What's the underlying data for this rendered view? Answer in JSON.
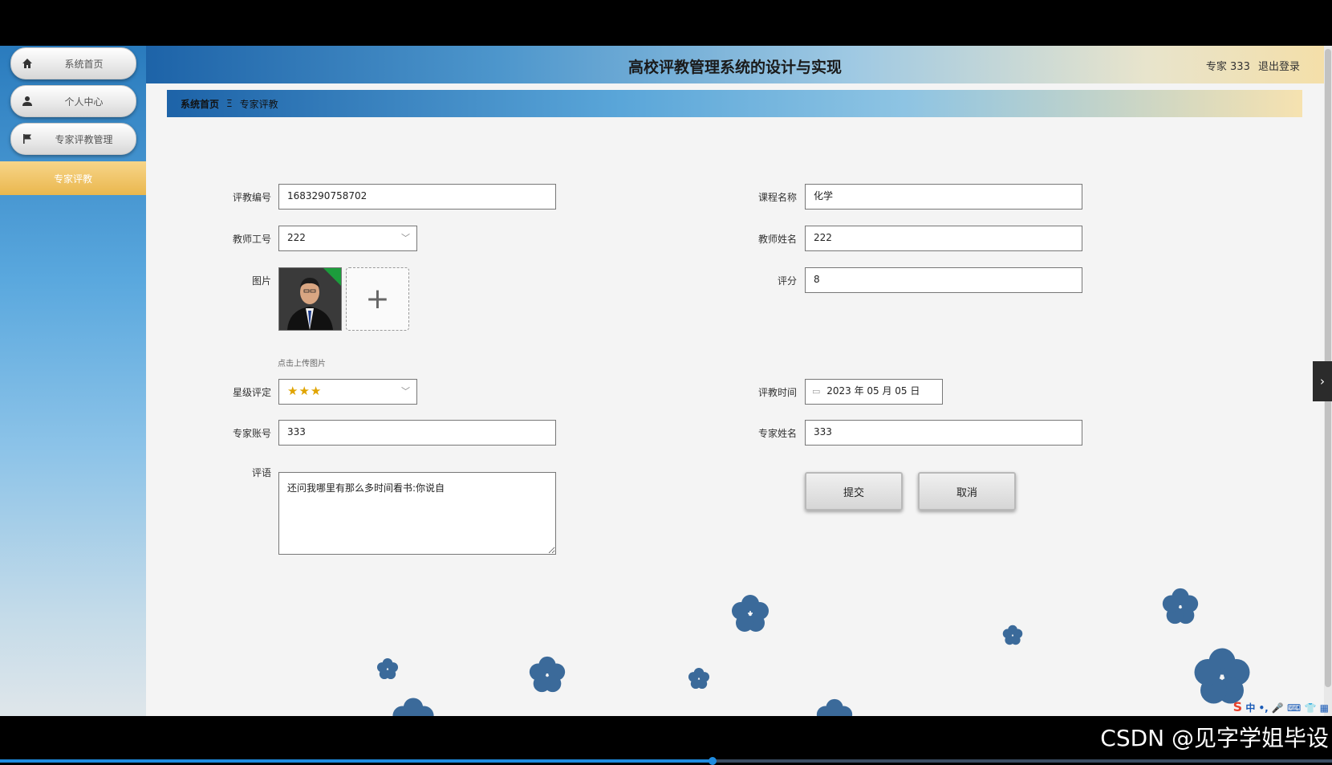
{
  "app": {
    "title": "高校评教管理系统的设计与实现",
    "user_label": "专家 333",
    "logout_label": "退出登录"
  },
  "sidebar": {
    "items": [
      {
        "label": "系统首页",
        "icon": "home-icon"
      },
      {
        "label": "个人中心",
        "icon": "user-icon"
      },
      {
        "label": "专家评教管理",
        "icon": "flag-icon"
      }
    ],
    "active_sub": "专家评教"
  },
  "breadcrumb": {
    "home": "系统首页",
    "separator": "Ξ",
    "current": "专家评教"
  },
  "form": {
    "eval_no": {
      "label": "评教编号",
      "value": "1683290758702"
    },
    "course_name": {
      "label": "课程名称",
      "value": "化学"
    },
    "teacher_id": {
      "label": "教师工号",
      "value": "222"
    },
    "teacher_name": {
      "label": "教师姓名",
      "value": "222"
    },
    "image": {
      "label": "图片",
      "hint": "点击上传图片"
    },
    "score": {
      "label": "评分",
      "value": "8"
    },
    "star_rating": {
      "label": "星级评定",
      "value": "★★★"
    },
    "eval_time": {
      "label": "评教时间",
      "value": "2023 年 05 月 05 日"
    },
    "expert_account": {
      "label": "专家账号",
      "value": "333"
    },
    "expert_name": {
      "label": "专家姓名",
      "value": "333"
    },
    "comment": {
      "label": "评语",
      "value": "还问我哪里有那么多时间看书:你说自"
    },
    "submit_label": "提交",
    "cancel_label": "取消"
  },
  "ime": {
    "text": "中 •, 🎤 ⌨ 👕 ▦"
  },
  "watermark": "CSDN @见字学姐毕设",
  "video_progress": 0.535,
  "colors": {
    "accent_gold": "#eab74e",
    "header_blue": "#1d63a8",
    "flower_blue": "#3b6a9a"
  }
}
